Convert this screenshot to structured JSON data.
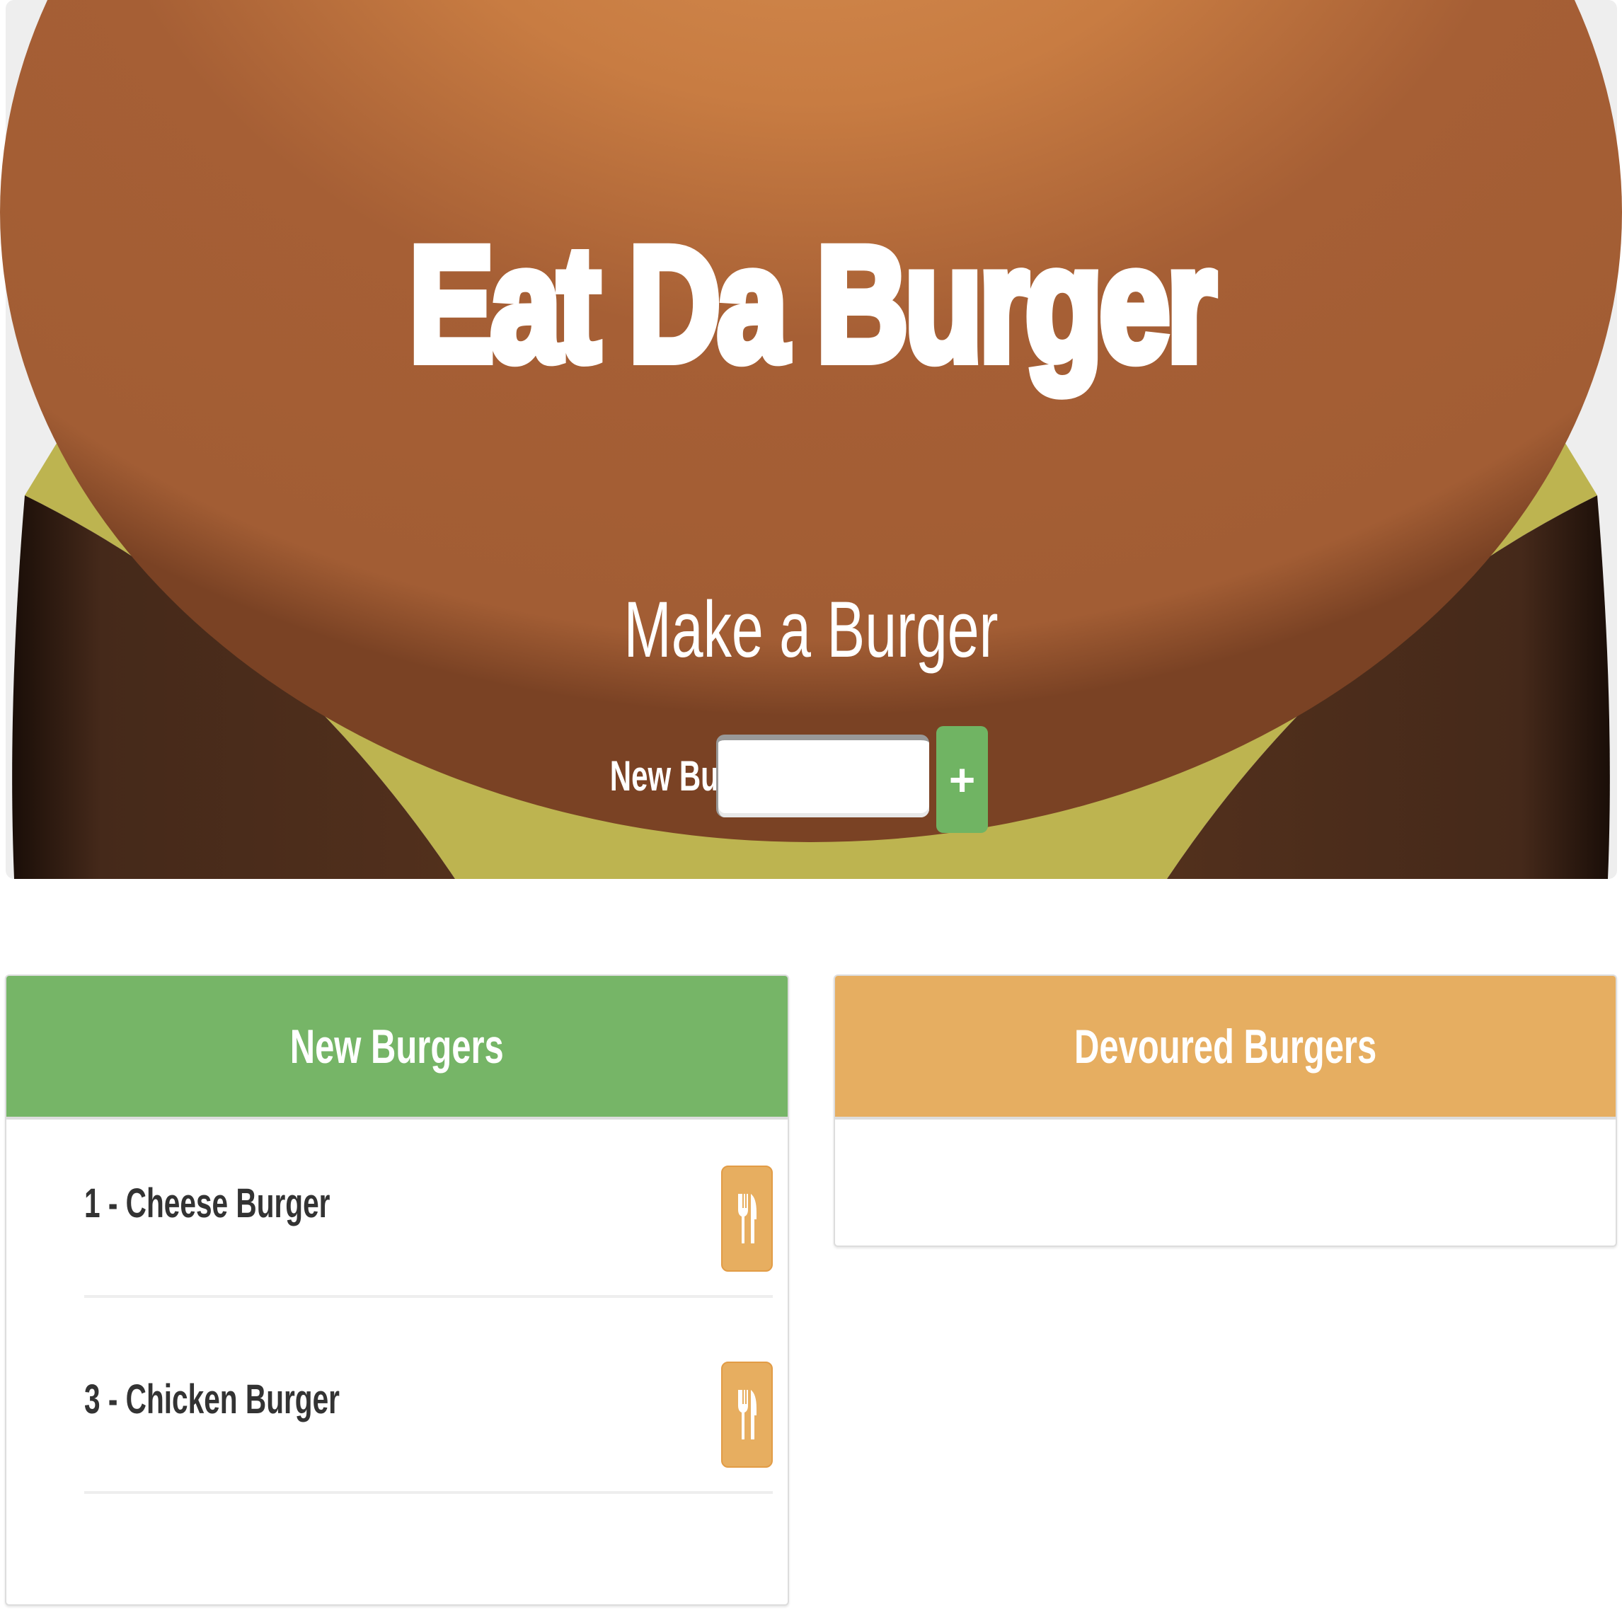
{
  "header": {
    "title": "Eat Da Burger",
    "subtitle": "Make a Burger"
  },
  "form": {
    "label": "New Burger:",
    "input_value": "",
    "add_button_label": "+"
  },
  "new_burgers": {
    "heading": "New Burgers",
    "items": [
      {
        "text": "1 - Cheese Burger",
        "icon": "utensils-icon"
      },
      {
        "text": "3 - Chicken Burger",
        "icon": "utensils-icon"
      }
    ]
  },
  "devoured_burgers": {
    "heading": "Devoured Burgers",
    "items": []
  },
  "colors": {
    "new_header": "#76b567",
    "devoured_header": "#e6ae61",
    "add_button": "#70b463",
    "eat_button": "#e7ae60"
  }
}
